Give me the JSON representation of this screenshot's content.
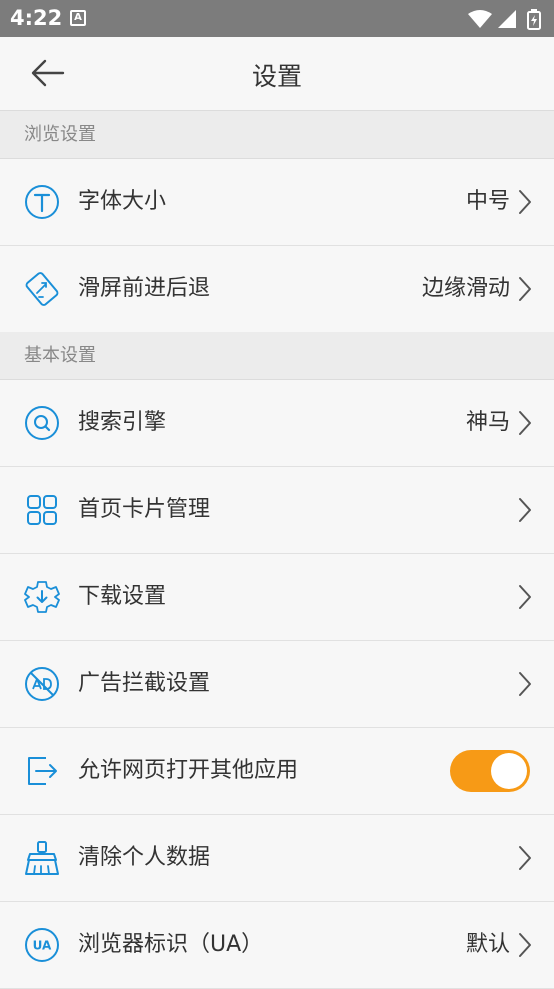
{
  "status_bar": {
    "time": "4:22",
    "notification_letter": "A"
  },
  "header": {
    "title": "设置"
  },
  "sections": [
    {
      "title": "浏览设置"
    },
    {
      "title": "基本设置"
    }
  ],
  "items": [
    {
      "label": "字体大小",
      "value": "中号",
      "icon": "font-size-icon"
    },
    {
      "label": "滑屏前进后退",
      "value": "边缘滑动",
      "icon": "swipe-gesture-icon"
    },
    {
      "label": "搜索引擎",
      "value": "神马",
      "icon": "search-icon"
    },
    {
      "label": "首页卡片管理",
      "value": "",
      "icon": "grid-cards-icon"
    },
    {
      "label": "下载设置",
      "value": "",
      "icon": "download-gear-icon"
    },
    {
      "label": "广告拦截设置",
      "value": "",
      "icon": "ad-block-icon"
    },
    {
      "label": "允许网页打开其他应用",
      "toggle_on": true,
      "icon": "open-external-icon"
    },
    {
      "label": "清除个人数据",
      "value": "",
      "icon": "broom-icon"
    },
    {
      "label": "浏览器标识（UA）",
      "value": "默认",
      "icon": "ua-icon",
      "icon_text": "UA"
    }
  ],
  "colors": {
    "icon_blue": "#1a8fd8",
    "toggle_on": "#f79a16"
  }
}
